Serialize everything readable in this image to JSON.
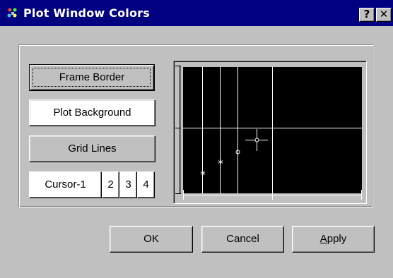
{
  "window": {
    "title": "Plot Window Colors",
    "help_label": "?",
    "close_label": "✕"
  },
  "settings": {
    "frame_border_label": "Frame Border",
    "plot_background_label": "Plot Background",
    "grid_lines_label": "Grid Lines",
    "cursor_labels": [
      "Cursor-1",
      "2",
      "3",
      "4"
    ]
  },
  "preview": {
    "background_color": "#000000",
    "grid_color": "#ffffff",
    "frame_color": "#c0c0c0",
    "markers": [
      "*",
      "*",
      "o",
      "cursor-crosshair"
    ]
  },
  "footer": {
    "ok_label": "OK",
    "cancel_label": "Cancel",
    "apply_label_first": "A",
    "apply_label_rest": "pply"
  }
}
